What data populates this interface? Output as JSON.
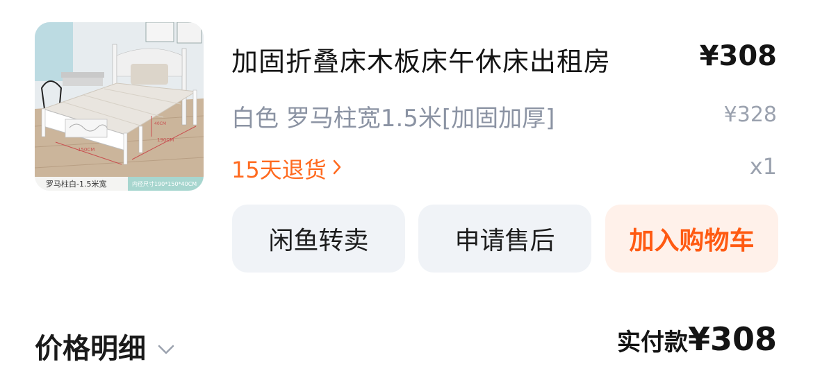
{
  "product": {
    "thumbnail": {
      "caption_left": "罗马柱白-1.5米宽",
      "caption_right": "内径尺寸190*150*40CM",
      "dimension_labels": [
        "150CM",
        "190CM",
        "40CM"
      ]
    },
    "title": "加固折叠床木板床午休床出租房",
    "price": "¥308",
    "variant": "白色 罗马柱宽1.5米[加固加厚]",
    "original_price": "¥328",
    "returns_label": "15天退货",
    "quantity": "x1"
  },
  "actions": {
    "resell_label": "闲鱼转卖",
    "after_sales_label": "申请售后",
    "add_to_cart_label": "加入购物车"
  },
  "summary": {
    "breakdown_label": "价格明细",
    "paid_label": "实付款",
    "paid_amount": "¥308"
  },
  "colors": {
    "accent": "#ff5a12",
    "muted_text": "#8b93a3",
    "button_gray": "#f0f3f7",
    "button_orange_bg": "#fff1ea"
  },
  "icons": {
    "returns_chevron": "chevron-right-icon",
    "breakdown_chevron": "chevron-down-icon"
  }
}
